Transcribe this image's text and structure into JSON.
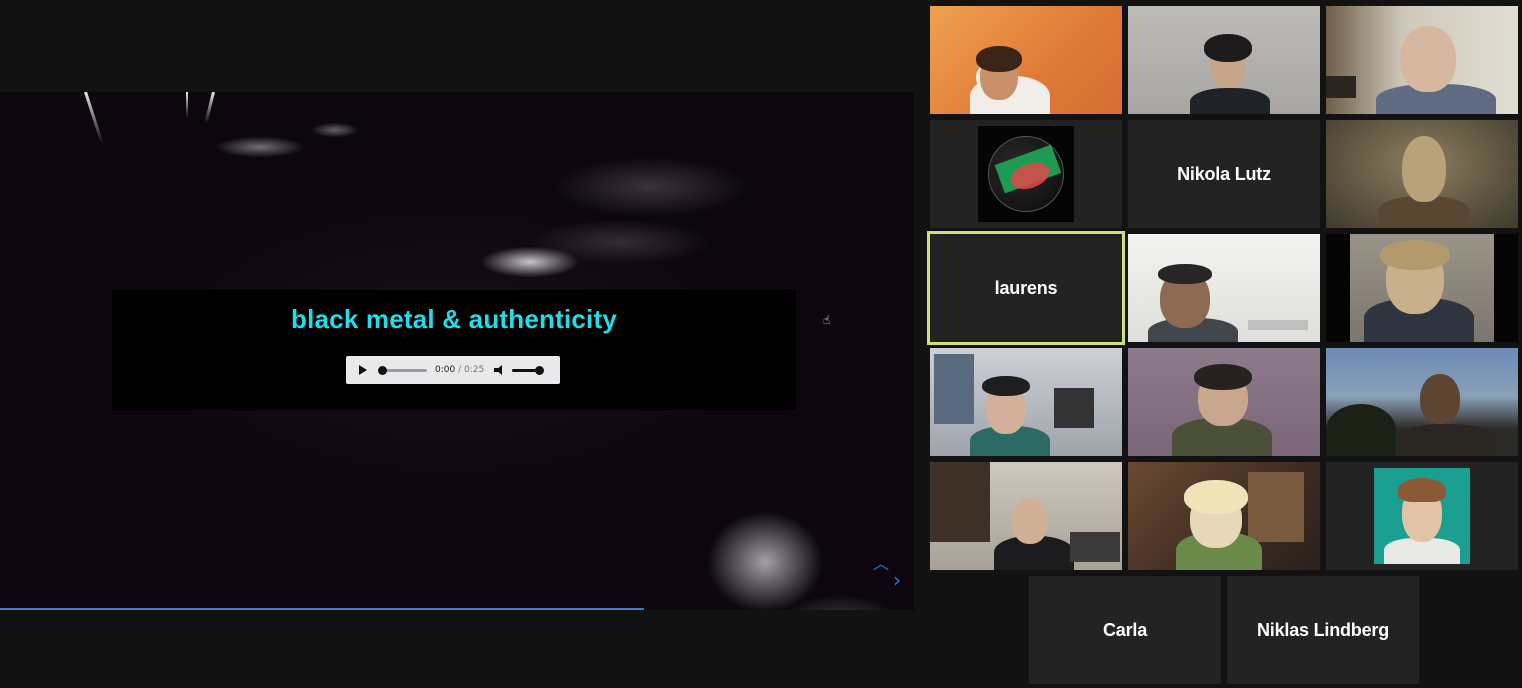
{
  "presentation": {
    "title": "black metal & authenticity",
    "audio": {
      "current_time": "0:00",
      "separator": " / ",
      "duration": "0:25",
      "volume": 1.0
    },
    "progress": 0.705
  },
  "participants": [
    {
      "name": "",
      "video": true
    },
    {
      "name": "",
      "video": true
    },
    {
      "name": "",
      "video": true
    },
    {
      "name": "",
      "video": false,
      "avatar": "abstract-logo"
    },
    {
      "name": "Nikola Lutz",
      "video": false
    },
    {
      "name": "",
      "video": true
    },
    {
      "name": "laurens",
      "video": false,
      "active_speaker": true
    },
    {
      "name": "",
      "video": true
    },
    {
      "name": "",
      "video": true
    },
    {
      "name": "",
      "video": true
    },
    {
      "name": "",
      "video": true
    },
    {
      "name": "",
      "video": true
    },
    {
      "name": "",
      "video": true
    },
    {
      "name": "",
      "video": true
    },
    {
      "name": "",
      "video": false,
      "avatar": "portrait-photo"
    },
    {
      "name": "Carla",
      "video": false
    },
    {
      "name": "Niklas Lindberg",
      "video": false
    }
  ],
  "colors": {
    "title": "#22dde8",
    "active_speaker_border": "#cfe27a",
    "progress": "#3b7fd1",
    "nav_arrow": "#2a7ad6"
  },
  "icons": {
    "play": "play-icon",
    "mute": "volume-icon",
    "next": "chevron-right-icon",
    "up": "chevron-up-icon",
    "cursor": "hand-cursor-icon"
  }
}
